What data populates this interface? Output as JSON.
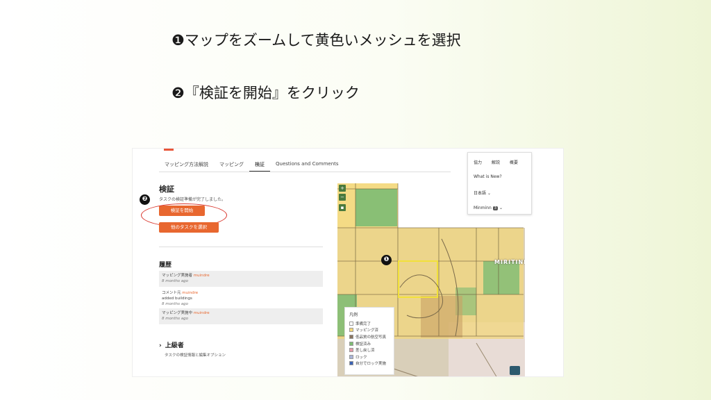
{
  "slide": {
    "step1_badge": "❶",
    "step1_text": "マップをズームして黄色いメッシュを選択",
    "step2_badge": "❷",
    "step2_text": "『検証を開始』をクリック"
  },
  "ui": {
    "tabs": [
      "マッピング方法解説",
      "マッピング",
      "検証",
      "Questions and Comments"
    ],
    "active_tab": "検証",
    "validate_title": "検証",
    "validate_note": "タスクの検証準備が完了しました。",
    "start_button": "検証を開始",
    "other_button": "他のタスクを選択",
    "history_title": "履歴",
    "history": [
      {
        "action": "マッピング実施者",
        "user": "muindre",
        "time": "8 months ago",
        "comment": ""
      },
      {
        "action": "コメント元",
        "user": "muindre",
        "comment": "added buildings",
        "time": "8 months ago"
      },
      {
        "action": "マッピング実施中",
        "user": "muindre",
        "time": "8 months ago",
        "comment": ""
      }
    ],
    "advanced_chevron": "›",
    "advanced_title": "上級者",
    "advanced_desc": "タスクの検証情報と編集オプション",
    "badge_annot_2": "❷",
    "badge_annot_1": "❶"
  },
  "map": {
    "place_label": "MIRITINI",
    "zoom_in": "+",
    "zoom_out": "−",
    "legend_title": "凡例",
    "legend": [
      {
        "label": "準備完了",
        "color": "#ffffff"
      },
      {
        "label": "マッピング済",
        "color": "#f5d77a"
      },
      {
        "label": "低品質の航空写真",
        "color": "#8a7560"
      },
      {
        "label": "検証済み",
        "color": "#7dbb73"
      },
      {
        "label": "差し戻し済",
        "color": "#e79aa8"
      },
      {
        "label": "ロック",
        "color": "#a9b4d8"
      },
      {
        "label": "自分でロック実施",
        "color": "#3b63b5"
      }
    ],
    "colors": {
      "mapped": "#f3d778",
      "validated": "#7dbb73",
      "selected_outline": "#f2e13a",
      "grid": "#6b5a3a"
    }
  },
  "dropdown": {
    "top_items": [
      "協力",
      "解説",
      "概要"
    ],
    "whats_new": "What is New?",
    "language": "日本語",
    "user": "Minminn",
    "user_count": "3",
    "chevron": "⌄"
  }
}
